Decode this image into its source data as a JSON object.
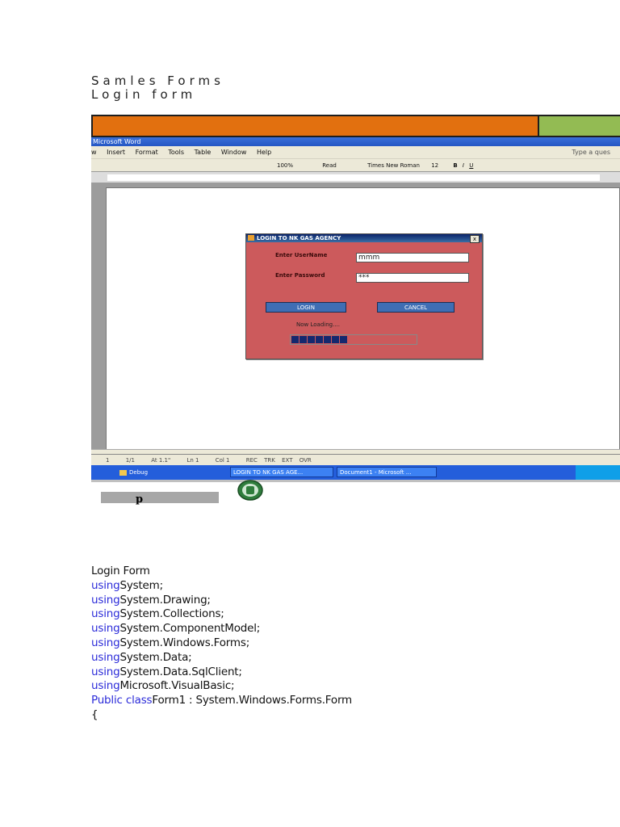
{
  "headings": {
    "line1": "Samles Forms",
    "line2": "Login form"
  },
  "screenshot": {
    "colors": {
      "orange_bar": "#e2700f",
      "green_bar": "#93bb53",
      "dialog_bg": "#cc5a5c"
    },
    "word_title": "Microsoft Word",
    "menu": [
      "w",
      "Insert",
      "Format",
      "Tools",
      "Table",
      "Window",
      "Help"
    ],
    "type_question": "Type a ques",
    "toolbar": {
      "zoom": "100%",
      "read": "Read",
      "font": "Times New Roman",
      "size": "12"
    },
    "dialog": {
      "title": "LOGIN TO NK GAS AGENCY",
      "close": "x",
      "username_label": "Enter UserName",
      "username_value": "mmm",
      "password_label": "Enter Password",
      "password_value": "***",
      "login_button": "LOGIN",
      "cancel_button": "CANCEL",
      "loading_text": "Now Loading....",
      "progress_fraction": 0.5
    },
    "status": [
      "1",
      "1/1",
      "At 1.1\"",
      "Ln 1",
      "Col 1",
      "REC",
      "TRK",
      "EXT",
      "OVR"
    ],
    "taskbar": {
      "folder": "Debug",
      "task1": "LOGIN TO NK GAS AGE...",
      "task2": "Document1 - Microsoft ..."
    }
  },
  "below_shot": {
    "letter": "p",
    "icon": "circular-green-logo-icon"
  },
  "code": {
    "title": "Login Form",
    "lines": [
      {
        "kw": "using",
        "text": "System;"
      },
      {
        "kw": "using",
        "text": "System.Drawing;"
      },
      {
        "kw": "using",
        "text": "System.Collections;"
      },
      {
        "kw": "using",
        "text": "System.ComponentModel;"
      },
      {
        "kw": "using",
        "text": "System.Windows.Forms;"
      },
      {
        "kw": "using",
        "text": "System.Data;"
      },
      {
        "kw": "using",
        "text": "System.Data.SqlClient;"
      },
      {
        "kw": "using",
        "text": "Microsoft.VisualBasic;"
      },
      {
        "kw": "Public class",
        "text": "Form1 : System.Windows.Forms.Form"
      }
    ],
    "brace": "{"
  }
}
